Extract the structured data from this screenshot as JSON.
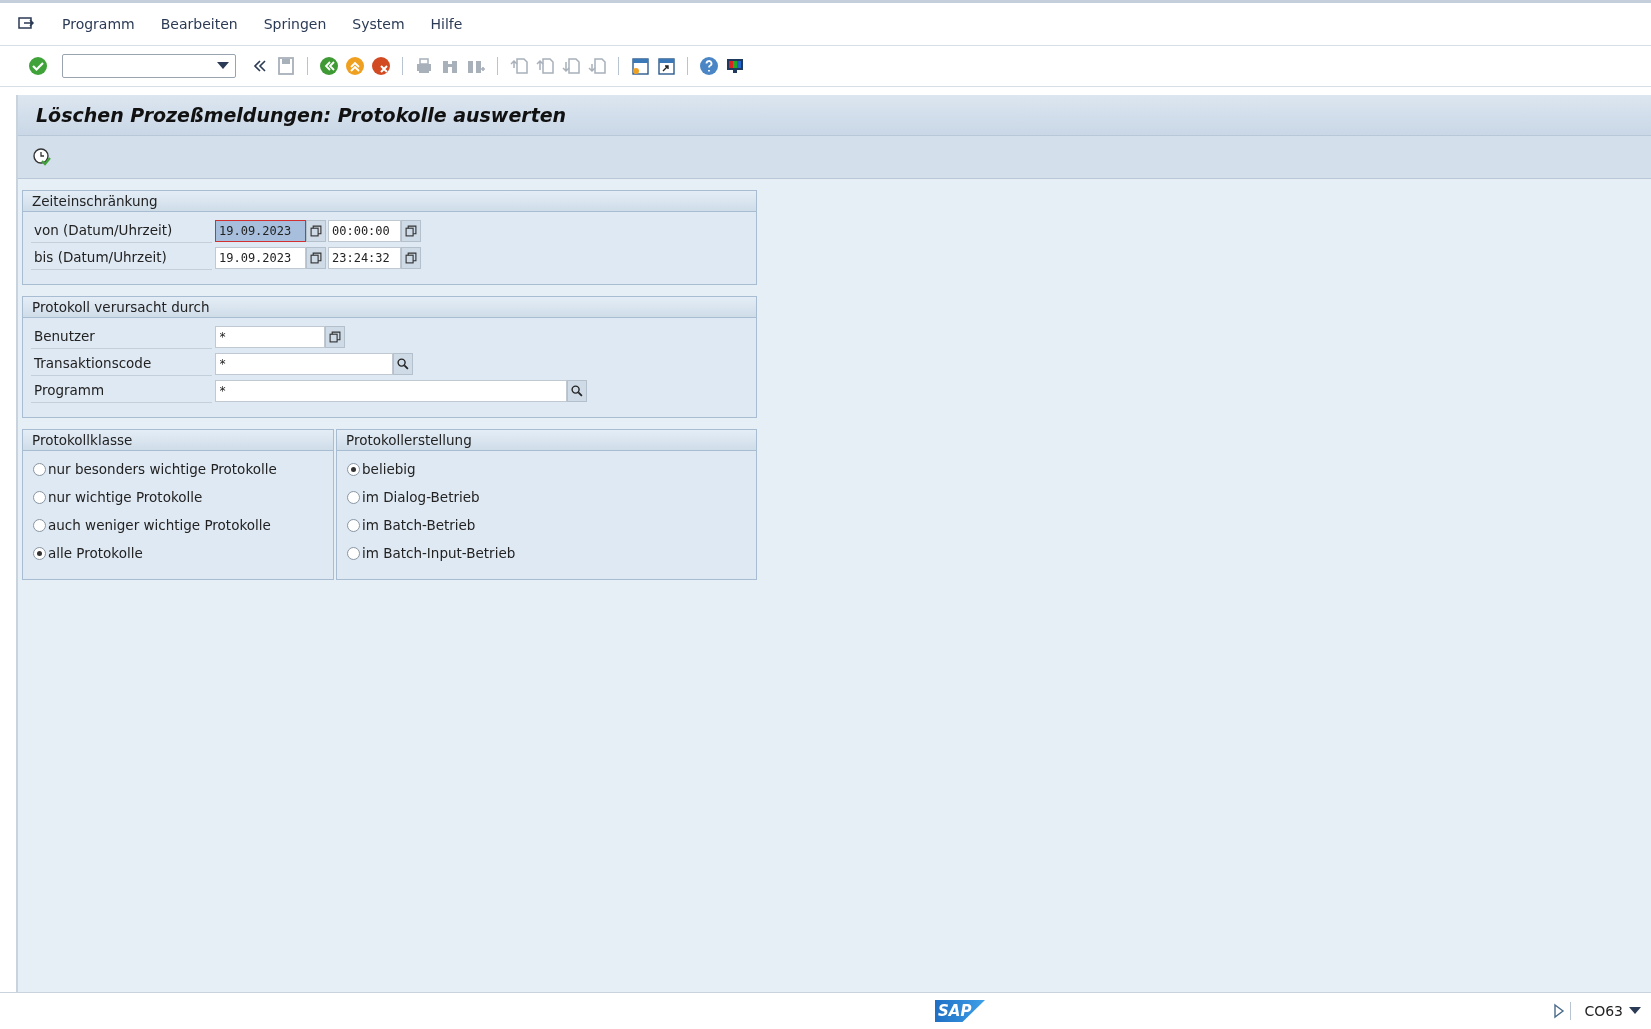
{
  "menu": [
    "Programm",
    "Bearbeiten",
    "Springen",
    "System",
    "Hilfe"
  ],
  "title": "Löschen Prozeßmeldungen: Protokolle auswerten",
  "groups": [
    {
      "title": "Zeiteinschränkung",
      "rows": [
        {
          "label": "von (Datum/Uhrzeit)",
          "inputs": [
            {
              "value": "19.09.2023",
              "kind": "multi",
              "focused": true
            },
            {
              "value": "00:00:00",
              "kind": "multi",
              "focused": false
            }
          ]
        },
        {
          "label": "bis (Datum/Uhrzeit)",
          "inputs": [
            {
              "value": "19.09.2023",
              "kind": "multi",
              "focused": false
            },
            {
              "value": "23:24:32",
              "kind": "multi",
              "focused": false
            }
          ]
        }
      ]
    },
    {
      "title": "Protokoll verursacht durch",
      "rows": [
        {
          "label": "Benutzer",
          "inputs": [
            {
              "value": "*",
              "kind": "multi",
              "focused": false
            }
          ]
        },
        {
          "label": "Transaktionscode",
          "inputs": [
            {
              "value": "*",
              "kind": "search",
              "focused": false
            }
          ]
        },
        {
          "label": "Programm",
          "inputs": [
            {
              "value": "*",
              "kind": "search",
              "focused": false
            }
          ]
        }
      ]
    }
  ],
  "radio_groups": [
    {
      "title": "Protokollklasse",
      "options": [
        {
          "label": "nur besonders wichtige Protokolle",
          "selected": false
        },
        {
          "label": "nur wichtige Protokolle",
          "selected": false
        },
        {
          "label": "auch weniger wichtige Protokolle",
          "selected": false
        },
        {
          "label": "alle Protokolle",
          "selected": true
        }
      ]
    },
    {
      "title": "Protokollerstellung",
      "options": [
        {
          "label": "beliebig",
          "selected": true
        },
        {
          "label": "im Dialog-Betrieb",
          "selected": false
        },
        {
          "label": "im Batch-Betrieb",
          "selected": false
        },
        {
          "label": "im Batch-Input-Betrieb",
          "selected": false
        }
      ]
    }
  ],
  "status_bar": {
    "logo": "SAP",
    "transaction": "CO63"
  }
}
